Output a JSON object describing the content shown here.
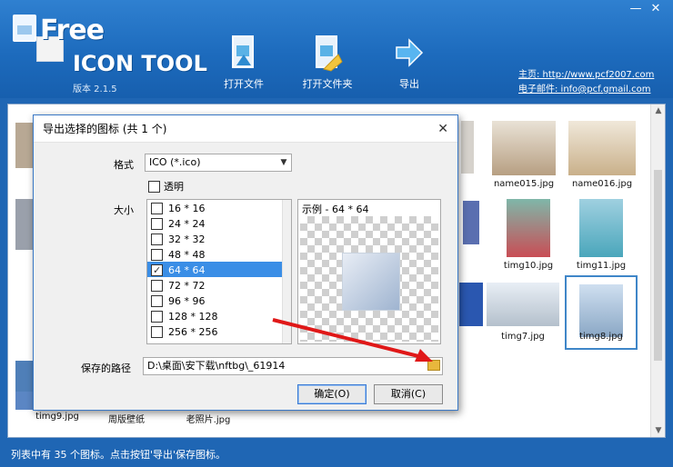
{
  "app": {
    "logo_free": "Free",
    "logo_tool": "ICON TOOL",
    "version": "版本 2.1.5"
  },
  "toolbar": {
    "open_file": "打开文件",
    "open_folder": "打开文件夹",
    "export": "导出"
  },
  "links": {
    "homepage": "主页: http://www.pcf2007.com",
    "email": "电子邮件: info@pcf.gmail.com"
  },
  "thumbnails": {
    "name015": "name015.jpg",
    "name016": "name016.jpg",
    "timg10": "timg10.jpg",
    "timg11": "timg11.jpg",
    "timg7": "timg7.jpg",
    "timg8": "timg8.jpg",
    "timg9": "timg9.jpg",
    "wallpaper": "周版壁纸",
    "photo": "老照片.jpg"
  },
  "dialog": {
    "title": "导出选择的图标 (共 1 个)",
    "format_label": "格式",
    "format_value": "ICO (*.ico)",
    "transparent_label": "透明",
    "size_label": "大小",
    "sizes": [
      "16 * 16",
      "24 * 24",
      "32 * 32",
      "48 * 48",
      "64 * 64",
      "72 * 72",
      "96 * 96",
      "128 * 128",
      "256 * 256"
    ],
    "selected_size": "64 * 64",
    "preview_label": "示例 - 64 * 64",
    "path_label": "保存的路径",
    "path_value": "D:\\桌面\\安下载\\nftbg\\_61914",
    "ok": "确定(O)",
    "cancel": "取消(C)"
  },
  "status": "列表中有 35 个图标。点击按钮'导出'保存图标。",
  "colors": {
    "header_blue": "#1d6bbd",
    "selected_row": "#3a8ee6",
    "arrow_red": "#e01818"
  },
  "icons": [
    "open-file-icon",
    "open-folder-icon",
    "export-arrow-icon",
    "folder-browse-icon",
    "minimize-icon",
    "close-icon"
  ]
}
